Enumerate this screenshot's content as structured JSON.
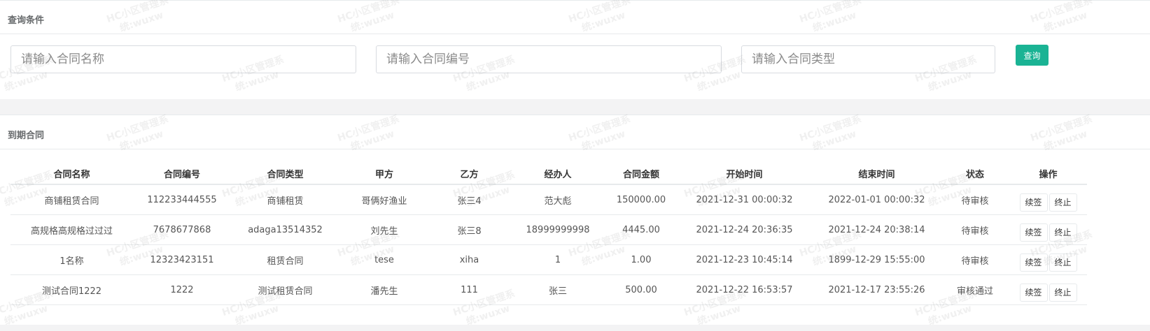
{
  "search": {
    "title": "查询条件",
    "name_placeholder": "请输入合同名称",
    "code_placeholder": "请输入合同编号",
    "type_placeholder": "请输入合同类型",
    "query_label": "查询"
  },
  "contracts": {
    "title": "到期合同",
    "columns": [
      "合同名称",
      "合同编号",
      "合同类型",
      "甲方",
      "乙方",
      "经办人",
      "合同金额",
      "开始时间",
      "结束时间",
      "状态",
      "操作"
    ],
    "rows": [
      {
        "name": "商铺租赁合同",
        "code": "112233444555",
        "type": "商铺租赁",
        "party_a": "哥俩好渔业",
        "party_b": "张三4",
        "handler": "范大彪",
        "amount": "150000.00",
        "start": "2021-12-31 00:00:32",
        "end": "2022-01-01 00:00:32",
        "status": "待审核",
        "renew": "续签",
        "terminate": "终止"
      },
      {
        "name": "高规格高规格过过过",
        "code": "7678677868",
        "type": "adaga13514352",
        "party_a": "刘先生",
        "party_b": "张三8",
        "handler": "18999999998",
        "amount": "4445.00",
        "start": "2021-12-24 20:36:35",
        "end": "2021-12-24 20:38:14",
        "status": "待审核",
        "renew": "续签",
        "terminate": "终止"
      },
      {
        "name": "1名称",
        "code": "12323423151",
        "type": "租赁合同",
        "party_a": "tese",
        "party_b": "xiha",
        "handler": "1",
        "amount": "1.00",
        "start": "2021-12-23 10:45:14",
        "end": "1899-12-29 15:55:00",
        "status": "待审核",
        "renew": "续签",
        "terminate": "终止"
      },
      {
        "name": "测试合同1222",
        "code": "1222",
        "type": "测试租赁合同",
        "party_a": "潘先生",
        "party_b": "111",
        "handler": "张三",
        "amount": "500.00",
        "start": "2021-12-22 16:53:57",
        "end": "2021-12-17 23:55:26",
        "status": "审核通过",
        "renew": "续签",
        "terminate": "终止"
      }
    ]
  },
  "watermark": {
    "line1": "HC小区管理系",
    "line2": "统:wuxw"
  }
}
